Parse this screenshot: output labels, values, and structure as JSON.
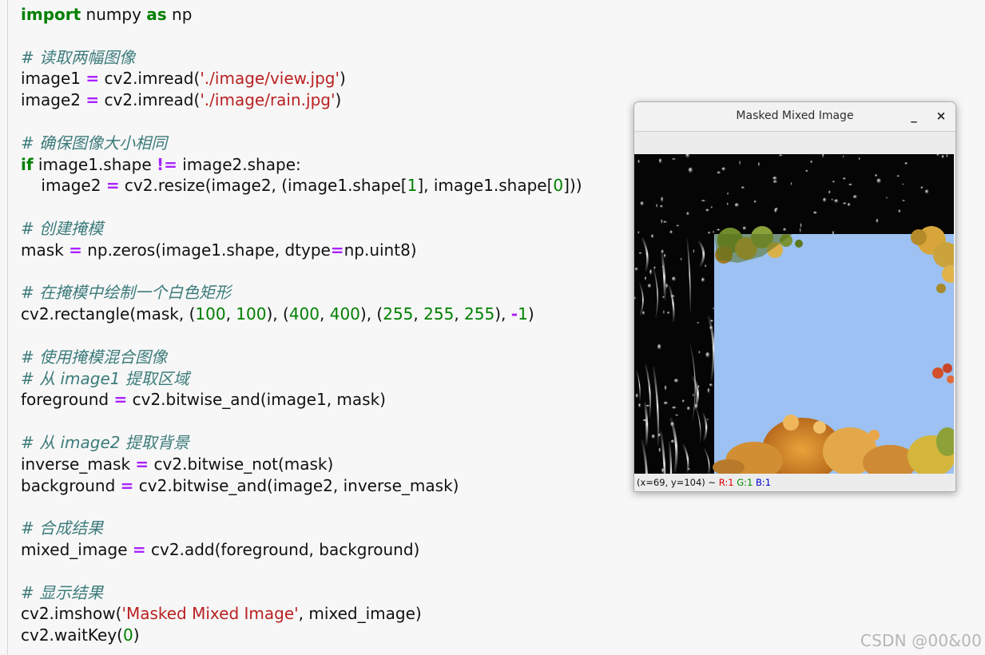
{
  "code_lines": [
    [
      {
        "t": "import",
        "c": "kw"
      },
      {
        "t": " numpy "
      },
      {
        "t": "as",
        "c": "kw"
      },
      {
        "t": " np"
      }
    ],
    [],
    [
      {
        "t": "# 读取两幅图像",
        "c": "cm"
      }
    ],
    [
      {
        "t": "image1 "
      },
      {
        "t": "=",
        "c": "op"
      },
      {
        "t": " cv2.imread("
      },
      {
        "t": "'./image/view.jpg'",
        "c": "str"
      },
      {
        "t": ")"
      }
    ],
    [
      {
        "t": "image2 "
      },
      {
        "t": "=",
        "c": "op"
      },
      {
        "t": " cv2.imread("
      },
      {
        "t": "'./image/rain.jpg'",
        "c": "str"
      },
      {
        "t": ")"
      }
    ],
    [],
    [
      {
        "t": "# 确保图像大小相同",
        "c": "cm"
      }
    ],
    [
      {
        "t": "if",
        "c": "kw"
      },
      {
        "t": " image1.shape "
      },
      {
        "t": "!=",
        "c": "op"
      },
      {
        "t": " image2.shape:"
      }
    ],
    [
      {
        "t": "    image2 "
      },
      {
        "t": "=",
        "c": "op"
      },
      {
        "t": " cv2.resize(image2, (image1.shape["
      },
      {
        "t": "1",
        "c": "num"
      },
      {
        "t": "], image1.shape["
      },
      {
        "t": "0",
        "c": "num"
      },
      {
        "t": "]))"
      }
    ],
    [],
    [
      {
        "t": "# 创建掩模",
        "c": "cm"
      }
    ],
    [
      {
        "t": "mask "
      },
      {
        "t": "=",
        "c": "op"
      },
      {
        "t": " np.zeros(image1.shape, dtype"
      },
      {
        "t": "=",
        "c": "op"
      },
      {
        "t": "np.uint8)"
      }
    ],
    [],
    [
      {
        "t": "# 在掩模中绘制一个白色矩形",
        "c": "cm"
      }
    ],
    [
      {
        "t": "cv2.rectangle(mask, ("
      },
      {
        "t": "100",
        "c": "num"
      },
      {
        "t": ", "
      },
      {
        "t": "100",
        "c": "num"
      },
      {
        "t": "), ("
      },
      {
        "t": "400",
        "c": "num"
      },
      {
        "t": ", "
      },
      {
        "t": "400",
        "c": "num"
      },
      {
        "t": "), ("
      },
      {
        "t": "255",
        "c": "num"
      },
      {
        "t": ", "
      },
      {
        "t": "255",
        "c": "num"
      },
      {
        "t": ", "
      },
      {
        "t": "255",
        "c": "num"
      },
      {
        "t": "), "
      },
      {
        "t": "-",
        "c": "op"
      },
      {
        "t": "1",
        "c": "num"
      },
      {
        "t": ")"
      }
    ],
    [],
    [
      {
        "t": "# 使用掩模混合图像",
        "c": "cm"
      }
    ],
    [
      {
        "t": "# 从 image1 提取区域",
        "c": "cm"
      }
    ],
    [
      {
        "t": "foreground "
      },
      {
        "t": "=",
        "c": "op"
      },
      {
        "t": " cv2.bitwise_and(image1, mask)"
      }
    ],
    [],
    [
      {
        "t": "# 从 image2 提取背景",
        "c": "cm"
      }
    ],
    [
      {
        "t": "inverse_mask "
      },
      {
        "t": "=",
        "c": "op"
      },
      {
        "t": " cv2.bitwise_not(mask)"
      }
    ],
    [
      {
        "t": "background "
      },
      {
        "t": "=",
        "c": "op"
      },
      {
        "t": " cv2.bitwise_and(image2, inverse_mask)"
      }
    ],
    [],
    [
      {
        "t": "# 合成结果",
        "c": "cm"
      }
    ],
    [
      {
        "t": "mixed_image "
      },
      {
        "t": "=",
        "c": "op"
      },
      {
        "t": " cv2.add(foreground, background)"
      }
    ],
    [],
    [
      {
        "t": "# 显示结果",
        "c": "cm"
      }
    ],
    [
      {
        "t": "cv2.imshow("
      },
      {
        "t": "'Masked Mixed Image'",
        "c": "str"
      },
      {
        "t": ", mixed_image)"
      }
    ],
    [
      {
        "t": "cv2.waitKey("
      },
      {
        "t": "0",
        "c": "num"
      },
      {
        "t": ")"
      }
    ]
  ],
  "window": {
    "title": "Masked Mixed Image",
    "minimize_label": "_",
    "close_label": "×",
    "status": {
      "coords": "(x=69, y=104) ~ ",
      "r": "R:1",
      "g": "G:1",
      "b": "B:1"
    }
  },
  "watermark": "CSDN @00&00",
  "colors": {
    "keyword": "#008000",
    "operator": "#aa22ff",
    "string": "#ba2121",
    "number": "#008000",
    "comment": "#3d7b7b",
    "sky": "#9cc1f2"
  }
}
